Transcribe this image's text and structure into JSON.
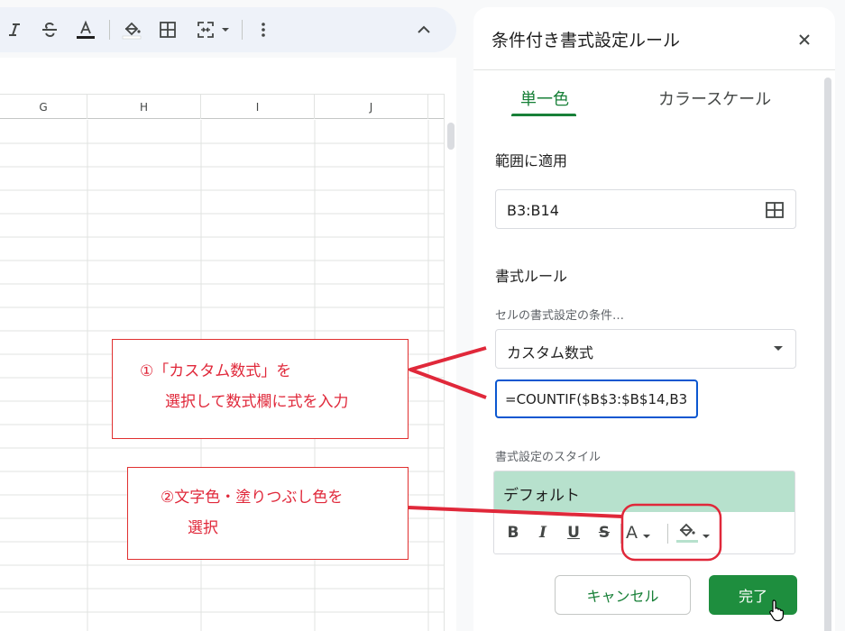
{
  "sheet": {
    "columns": [
      "G",
      "H",
      "I",
      "J"
    ]
  },
  "panel": {
    "title": "条件付き書式設定ルール",
    "tabs": [
      {
        "label": "単一色",
        "active": true
      },
      {
        "label": "カラースケール",
        "active": false
      }
    ],
    "range_label": "範囲に適用",
    "range_value": "B3:B14",
    "format_rules_label": "書式ルール",
    "condition_label": "セルの書式設定の条件…",
    "condition_value": "カスタム数式",
    "formula_value": "=COUNTIF($B$3:$B$14,B3",
    "style_label": "書式設定のスタイル",
    "style_preview": "デフォルト",
    "format_buttons": {
      "bold": "B",
      "italic": "I",
      "underline": "U",
      "strike": "S",
      "text_color": "A"
    },
    "cancel_label": "キャンセル",
    "done_label": "完了"
  },
  "annotations": {
    "callout1": {
      "line1": "①「カスタム数式」を",
      "line2": "選択して数式欄に式を入力"
    },
    "callout2": {
      "line1": "②文字色・塗りつぶし色を",
      "line2": "選択"
    }
  },
  "colors": {
    "accent_green": "#188038",
    "done_green": "#1e8e3e",
    "preview_green": "#b7e1cd",
    "focus_blue": "#0b57d0",
    "annotation_red": "#e0283a"
  }
}
